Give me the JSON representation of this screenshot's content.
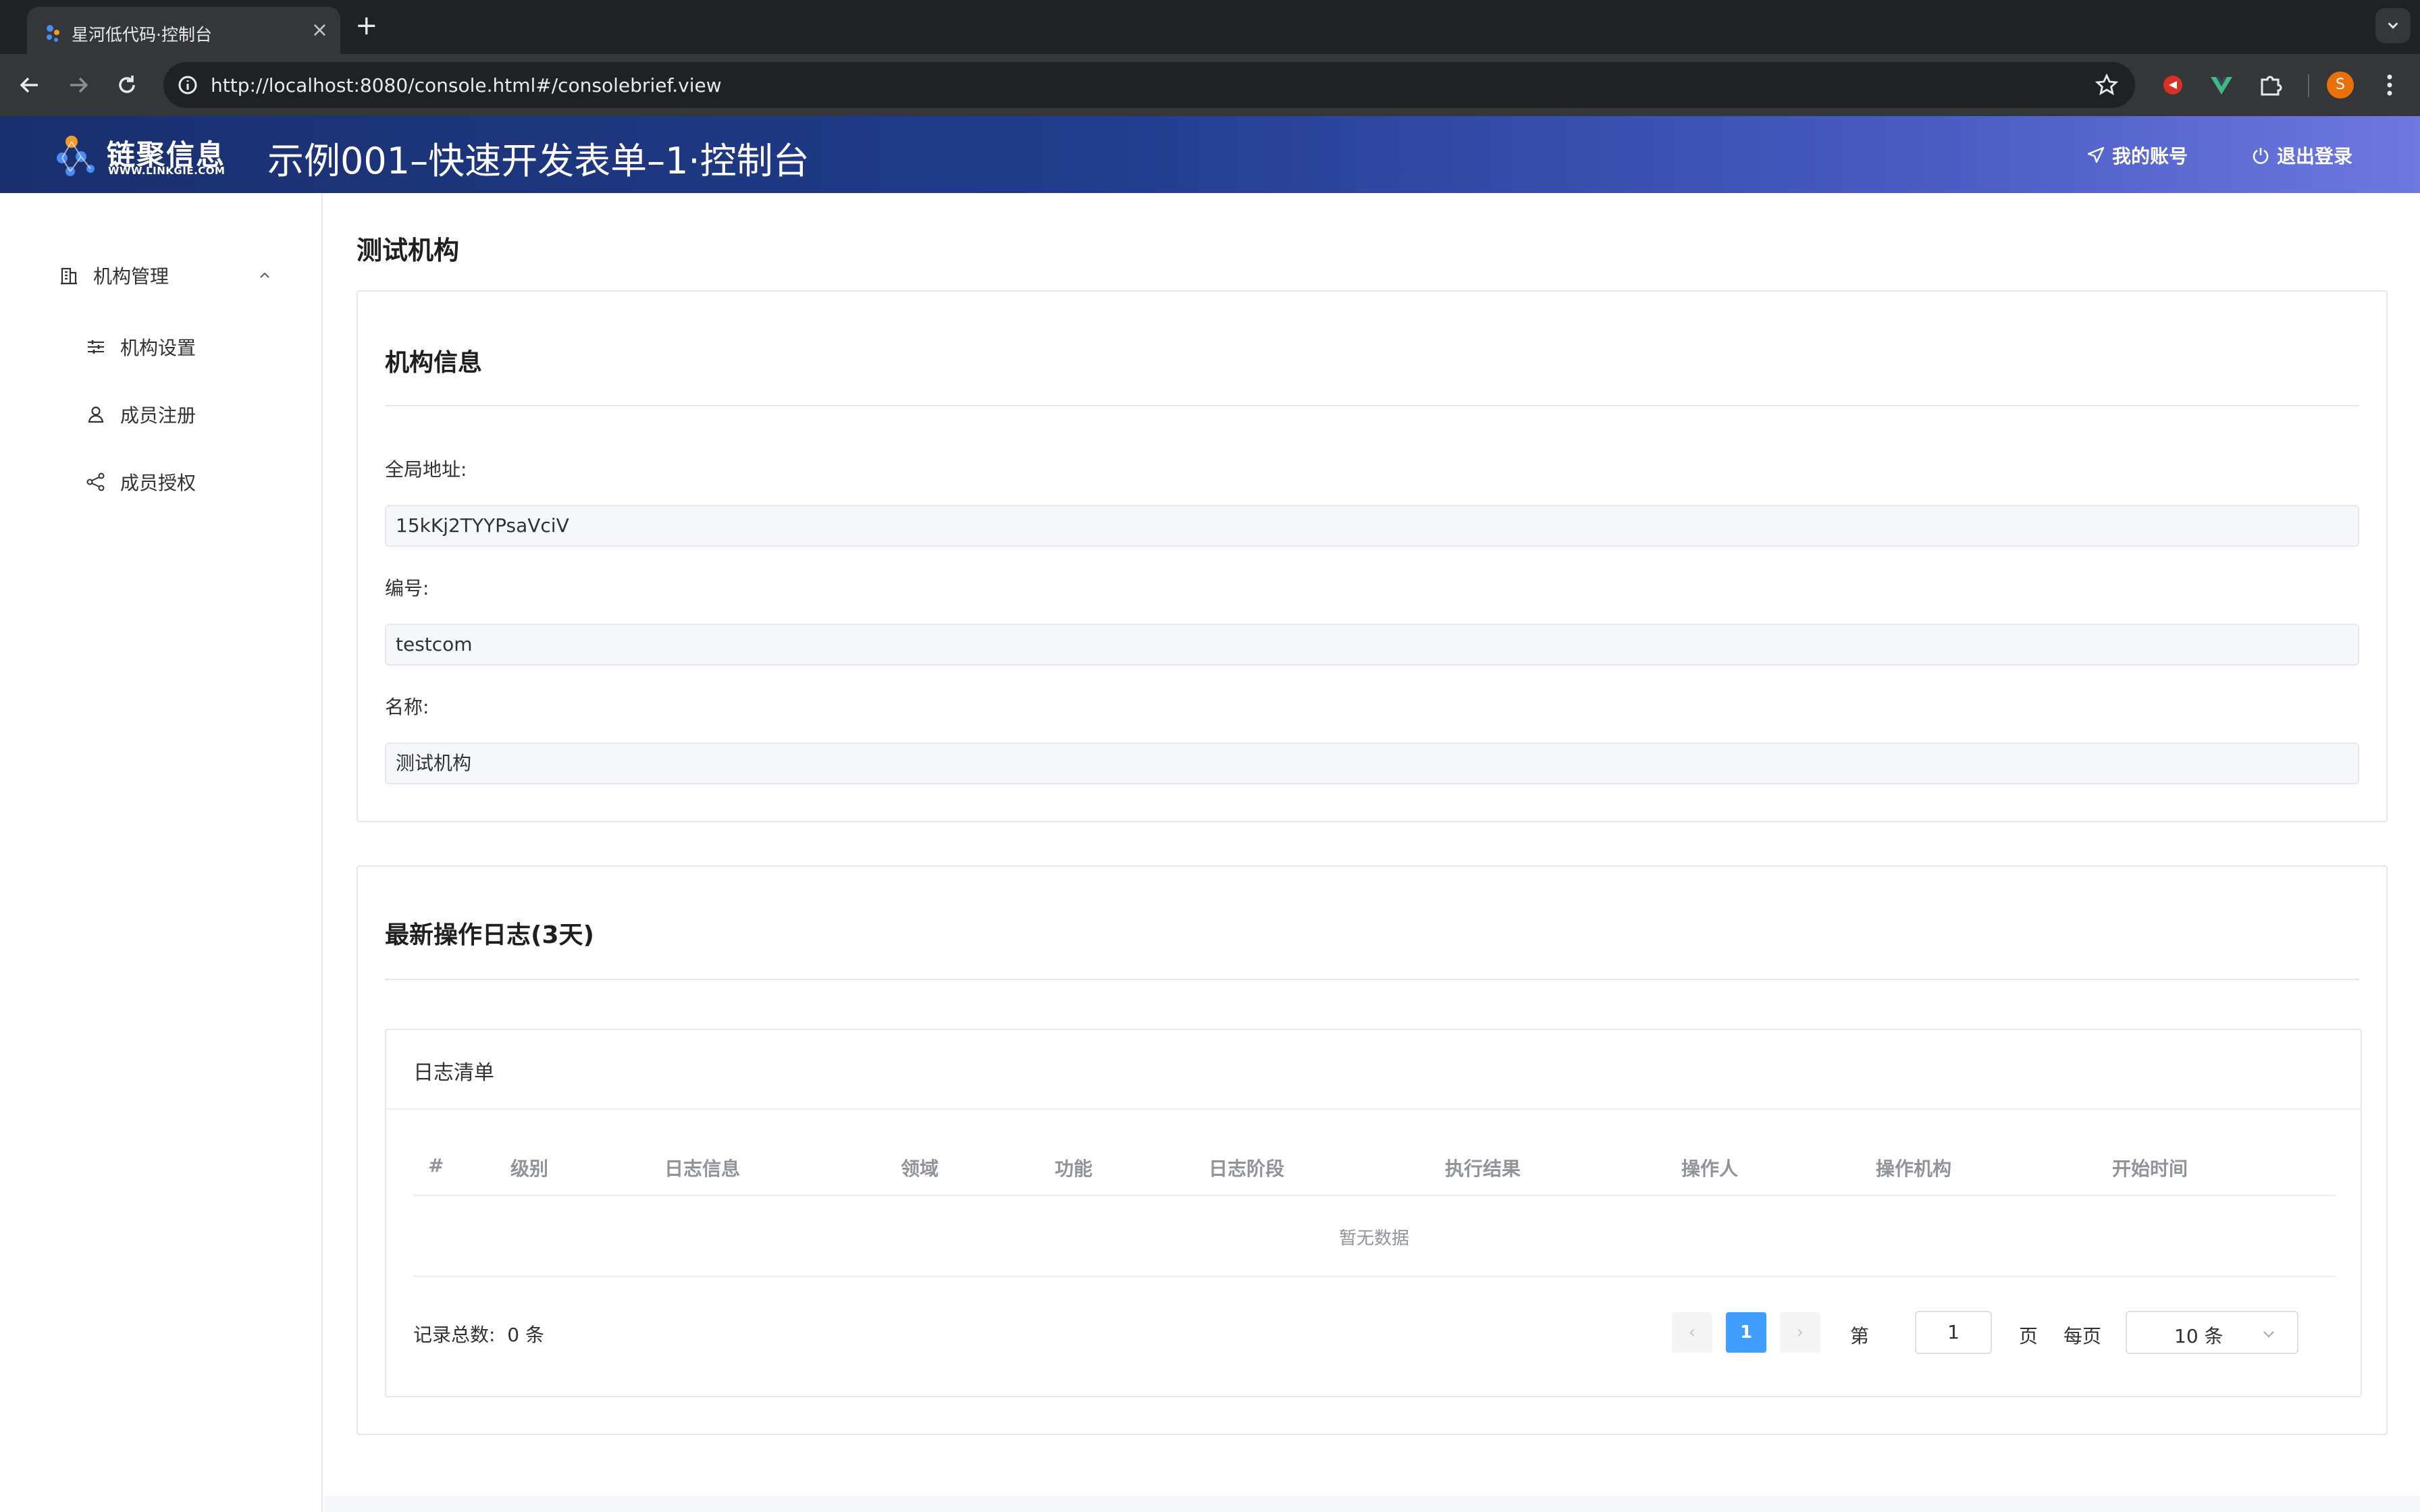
{
  "browser": {
    "tab_title": "星河低代码·控制台",
    "new_tab_label": "+",
    "url": "http://localhost:8080/console.html#/consolebrief.view",
    "profile_initial": "S",
    "extensions": [
      "extension-red-icon",
      "vue-devtools-icon",
      "puzzle-icon"
    ]
  },
  "header": {
    "logo_text": "链聚信息",
    "logo_sub": "WWW.LINKGIE.COM",
    "title": "示例001–快速开发表单–1·控制台",
    "my_account": "我的账号",
    "logout": "退出登录",
    "gradient_start": "#1a2f6e",
    "gradient_end": "#6d78e0"
  },
  "sidebar": {
    "group_label": "机构管理",
    "items": [
      {
        "label": "机构设置",
        "icon": "sliders-icon"
      },
      {
        "label": "成员注册",
        "icon": "user-icon"
      },
      {
        "label": "成员授权",
        "icon": "share-icon"
      }
    ]
  },
  "main": {
    "page_title": "测试机构",
    "org_card": {
      "title": "机构信息",
      "fields": [
        {
          "label": "全局地址:",
          "value": "15kKj2TYYPsaVciV"
        },
        {
          "label": "编号:",
          "value": "testcom"
        },
        {
          "label": "名称:",
          "value": "测试机构"
        }
      ]
    },
    "log_card": {
      "title": "最新操作日志(3天)",
      "panel_title": "日志清单",
      "columns": [
        "#",
        "级别",
        "日志信息",
        "领域",
        "功能",
        "日志阶段",
        "执行结果",
        "操作人",
        "操作机构",
        "开始时间"
      ],
      "rows": [],
      "empty_text": "暂无数据"
    },
    "pagination": {
      "total_label": "记录总数:",
      "total_value": "0 条",
      "prev": "‹",
      "next": "›",
      "current_page": "1",
      "page_prefix": "第",
      "page_input": "1",
      "page_suffix": "页",
      "per_page_label": "每页",
      "page_size": "10 条",
      "accent": "#409eff"
    }
  }
}
